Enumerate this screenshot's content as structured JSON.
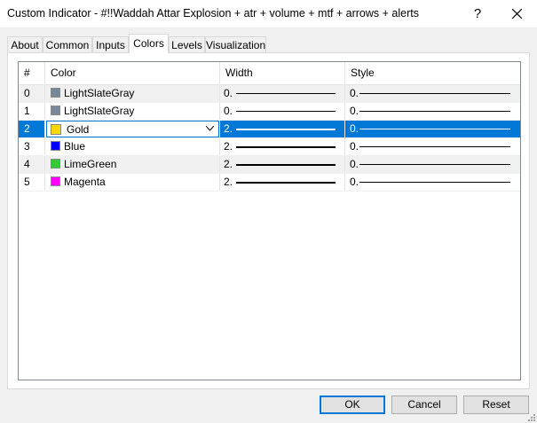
{
  "window": {
    "title": "Custom Indicator - #!!Waddah Attar Explosion + atr + volume + mtf + arrows + alerts",
    "help_label": "?"
  },
  "tabs": [
    {
      "label": "About"
    },
    {
      "label": "Common"
    },
    {
      "label": "Inputs"
    },
    {
      "label": "Colors"
    },
    {
      "label": "Levels"
    },
    {
      "label": "Visualization"
    }
  ],
  "active_tab": "Colors",
  "table": {
    "columns": [
      "#",
      "Color",
      "Width",
      "Style"
    ],
    "rows": [
      {
        "index": "0",
        "color": "LightSlateGray",
        "hex": "#778899",
        "width": "0.",
        "style": "0."
      },
      {
        "index": "1",
        "color": "LightSlateGray",
        "hex": "#778899",
        "width": "0.",
        "style": "0."
      },
      {
        "index": "2",
        "color": "Gold",
        "hex": "#ffd700",
        "width": "2.",
        "style": "0."
      },
      {
        "index": "3",
        "color": "Blue",
        "hex": "#0000ff",
        "width": "2.",
        "style": "0."
      },
      {
        "index": "4",
        "color": "LimeGreen",
        "hex": "#32cd32",
        "width": "2.",
        "style": "0."
      },
      {
        "index": "5",
        "color": "Magenta",
        "hex": "#ff00ff",
        "width": "2.",
        "style": "0."
      }
    ],
    "selected_row": 2
  },
  "buttons": {
    "ok": "OK",
    "cancel": "Cancel",
    "reset": "Reset"
  },
  "colors": {
    "selection": "#0078d7"
  }
}
